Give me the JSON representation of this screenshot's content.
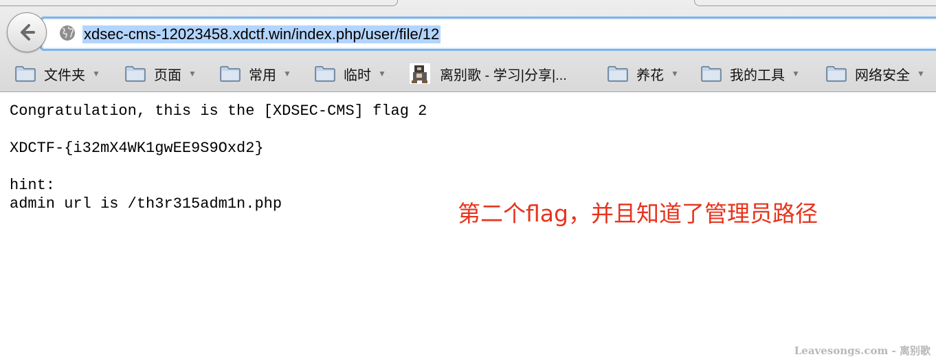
{
  "browser": {
    "url": "xdsec-cms-12023458.xdctf.win/index.php/user/file/12",
    "back_icon": "back-arrow-icon",
    "site_icon": "globe-icon"
  },
  "bookmarks": [
    {
      "label": "文件夹",
      "type": "folder",
      "dropdown": true
    },
    {
      "label": "页面",
      "type": "folder",
      "dropdown": true
    },
    {
      "label": "常用",
      "type": "folder",
      "dropdown": true
    },
    {
      "label": "临时",
      "type": "folder",
      "dropdown": true
    },
    {
      "label": "离别歌 - 学习|分享|...",
      "type": "site",
      "dropdown": false
    },
    {
      "label": "养花",
      "type": "folder",
      "dropdown": true
    },
    {
      "label": "我的工具",
      "type": "folder",
      "dropdown": true
    },
    {
      "label": "网络安全",
      "type": "folder",
      "dropdown": true
    }
  ],
  "page": {
    "line1": "Congratulation, this is the [XDSEC-CMS] flag 2",
    "line2": "XDCTF-{i32mX4WK1gwEE9S9Oxd2}",
    "line3": "hint:",
    "line4": "admin url is /th3r315adm1n.php"
  },
  "annotation": "第二个flag，并且知道了管理员路径",
  "watermark": "Leavesongs.com - 离别歌",
  "colors": {
    "url_highlight": "#b3d4fc",
    "url_border": "#7fb3ea",
    "annotation": "#e8331c"
  }
}
